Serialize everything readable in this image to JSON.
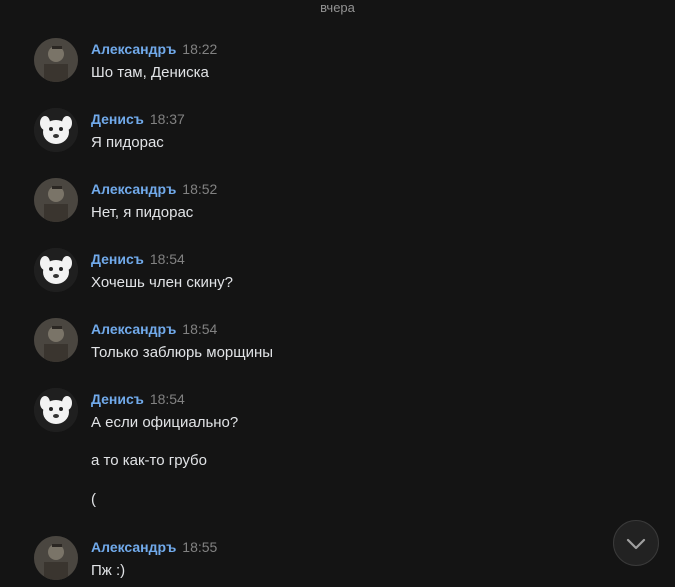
{
  "date_separator": "вчера",
  "messages": [
    {
      "author": "Александръ",
      "time": "18:22",
      "avatar": "man-photo-avatar",
      "lines": [
        "Шо там, Дениска"
      ]
    },
    {
      "author": "Денисъ",
      "time": "18:37",
      "avatar": "dog-avatar",
      "lines": [
        "Я пидорас"
      ]
    },
    {
      "author": "Александръ",
      "time": "18:52",
      "avatar": "man-photo-avatar",
      "lines": [
        "Нет, я пидорас"
      ]
    },
    {
      "author": "Денисъ",
      "time": "18:54",
      "avatar": "dog-avatar",
      "lines": [
        "Хочешь член скину?"
      ]
    },
    {
      "author": "Александръ",
      "time": "18:54",
      "avatar": "man-photo-avatar",
      "lines": [
        "Только заблюрь морщины"
      ]
    },
    {
      "author": "Денисъ",
      "time": "18:54",
      "avatar": "dog-avatar",
      "lines": [
        "А если официально?",
        "а то как-то грубо",
        "("
      ]
    },
    {
      "author": "Александръ",
      "time": "18:55",
      "avatar": "man-photo-avatar",
      "lines": [
        "Пж :)"
      ]
    }
  ],
  "scroll_button": {
    "icon": "chevron-down-icon"
  },
  "colors": {
    "background": "#141414",
    "author": "#71aaeb",
    "time": "#828282",
    "text": "#e1e3e6"
  }
}
